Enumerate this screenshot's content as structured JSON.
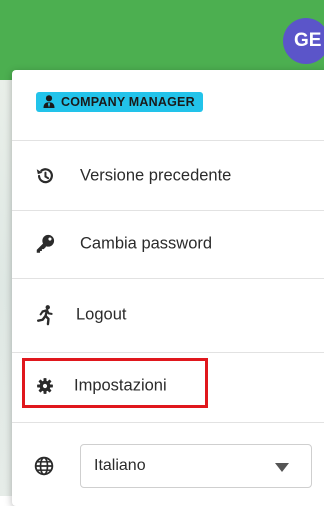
{
  "header": {
    "avatar_initials": "GE",
    "bar_color": "#4caf50",
    "avatar_color": "#5b55c9"
  },
  "menu": {
    "role_badge": {
      "label": "COMPANY MANAGER",
      "icon": "user-tie-icon",
      "color": "#22c3ea"
    },
    "items": [
      {
        "label": "Versione precedente",
        "icon": "history-icon"
      },
      {
        "label": "Cambia password",
        "icon": "key-icon"
      },
      {
        "label": "Logout",
        "icon": "running-person-icon"
      },
      {
        "label": "Impostazioni",
        "icon": "gear-icon",
        "highlighted": true
      }
    ],
    "language": {
      "icon": "globe-icon",
      "selected": "Italiano"
    },
    "highlight_color": "#e0171d"
  }
}
